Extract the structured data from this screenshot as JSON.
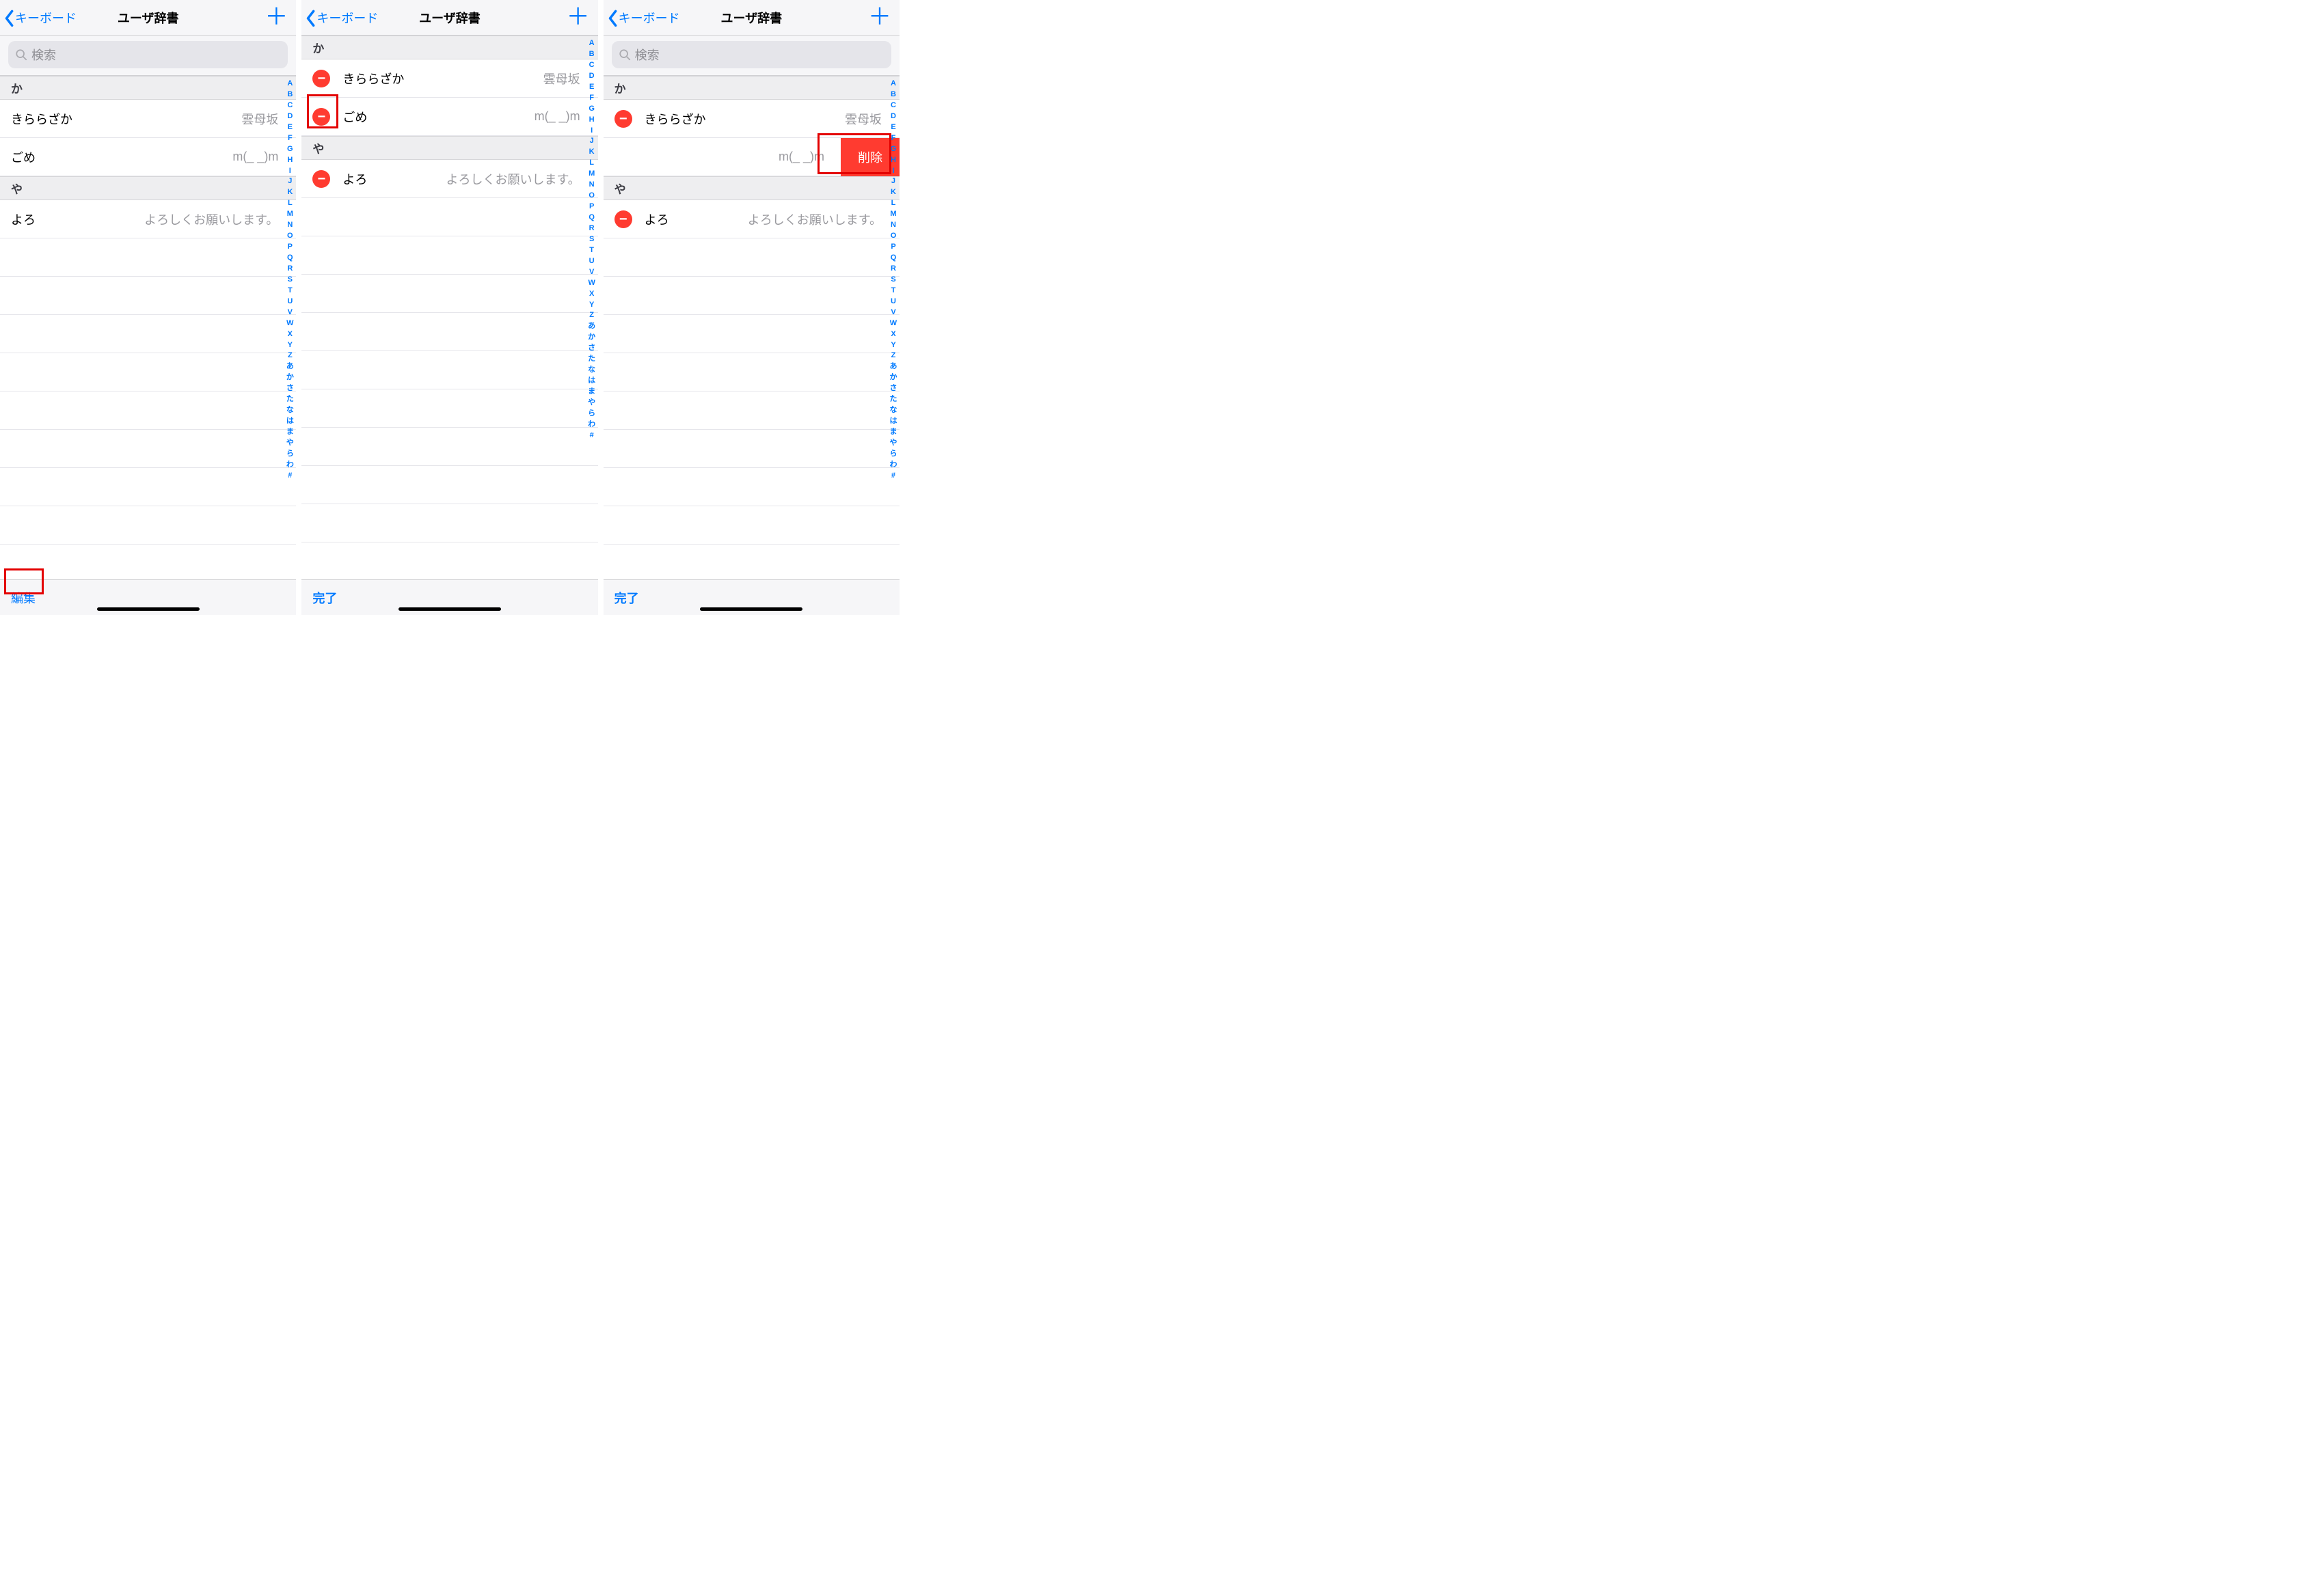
{
  "nav": {
    "back": "キーボード",
    "title": "ユーザ辞書"
  },
  "search_placeholder": "検索",
  "index_letters": [
    "A",
    "B",
    "C",
    "D",
    "E",
    "F",
    "G",
    "H",
    "I",
    "J",
    "K",
    "L",
    "M",
    "N",
    "O",
    "P",
    "Q",
    "R",
    "S",
    "T",
    "U",
    "V",
    "W",
    "X",
    "Y",
    "Z",
    "あ",
    "か",
    "さ",
    "た",
    "な",
    "は",
    "ま",
    "や",
    "ら",
    "わ",
    "#"
  ],
  "sections": {
    "ka": "か",
    "ya": "や"
  },
  "entries": {
    "kirarazaka": {
      "reading": "きららざか",
      "word": "雲母坂"
    },
    "gome": {
      "reading": "ごめ",
      "word": "m(_ _)m"
    },
    "yoro": {
      "reading": "よろ",
      "word": "よろしくお願いします。"
    }
  },
  "delete_label": "削除",
  "toolbar": {
    "edit": "編集",
    "done": "完了"
  }
}
